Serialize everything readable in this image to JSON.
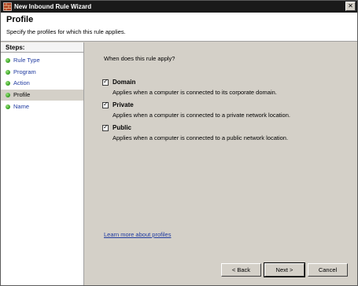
{
  "window": {
    "title": "New Inbound Rule Wizard",
    "close_glyph": "✕"
  },
  "header": {
    "title": "Profile",
    "subtitle": "Specify the profiles for which this rule applies."
  },
  "sidebar": {
    "heading": "Steps:",
    "items": [
      {
        "label": "Rule Type",
        "current": false
      },
      {
        "label": "Program",
        "current": false
      },
      {
        "label": "Action",
        "current": false
      },
      {
        "label": "Profile",
        "current": true
      },
      {
        "label": "Name",
        "current": false
      }
    ]
  },
  "main": {
    "question": "When does this rule apply?",
    "options": [
      {
        "name": "Domain",
        "checked": true,
        "description": "Applies when a computer is connected to its corporate domain."
      },
      {
        "name": "Private",
        "checked": true,
        "description": "Applies when a computer is connected to a private network location."
      },
      {
        "name": "Public",
        "checked": true,
        "description": "Applies when a computer is connected to a public network location."
      }
    ],
    "learn_more": "Learn more about profiles"
  },
  "buttons": {
    "back": "< Back",
    "next": "Next >",
    "cancel": "Cancel"
  },
  "icons": {
    "step_dot": "green-dot-icon",
    "app": "firewall-icon"
  }
}
